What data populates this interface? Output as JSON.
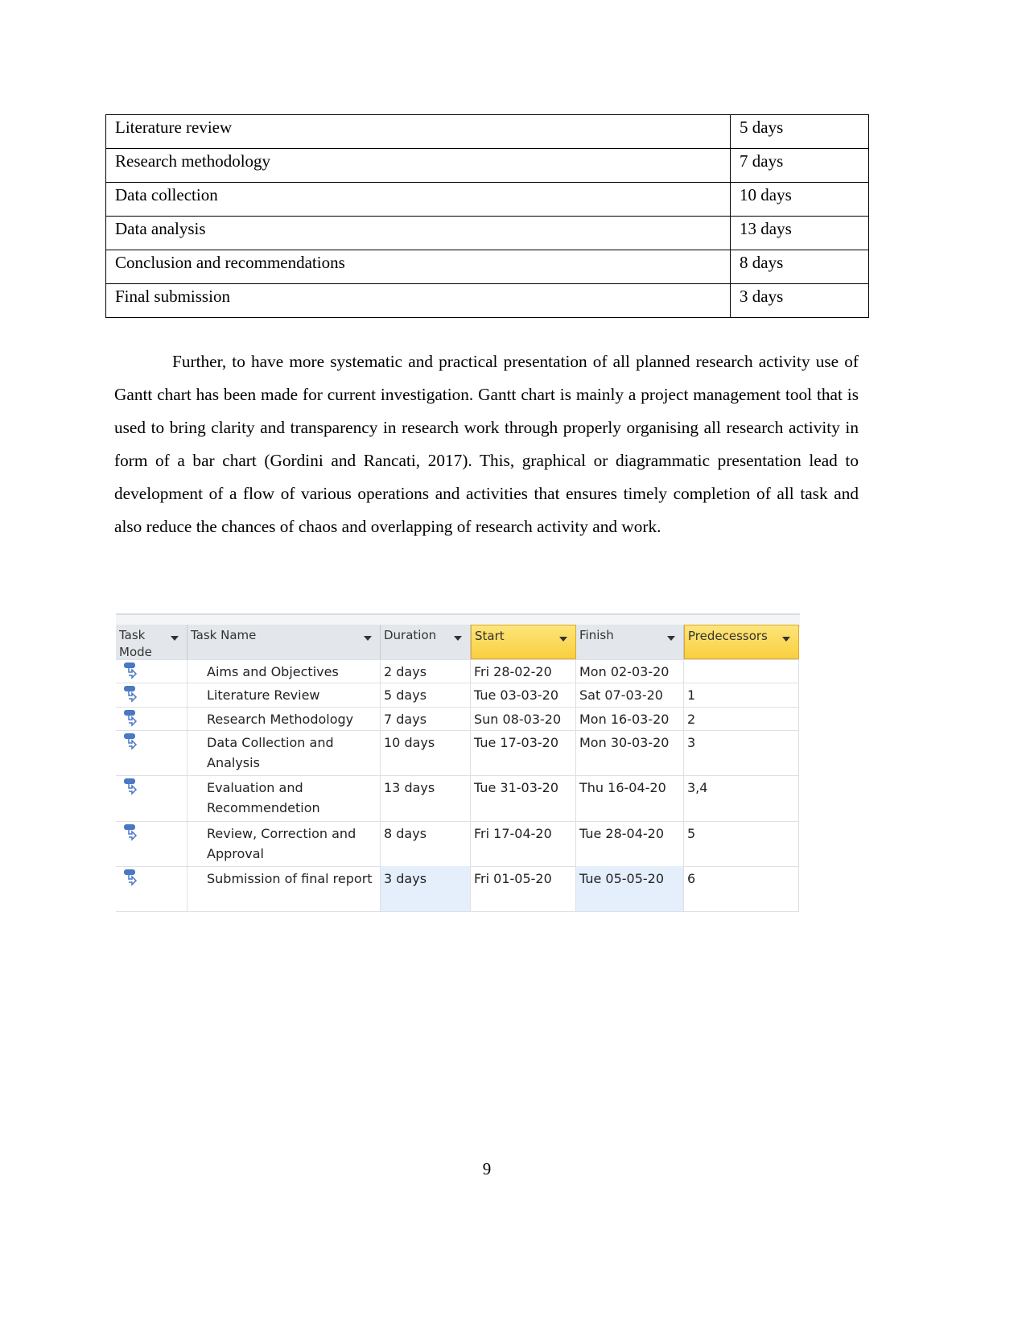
{
  "duration_table": [
    {
      "task": "Literature review",
      "duration": "5 days"
    },
    {
      "task": "Research methodology",
      "duration": "7 days"
    },
    {
      "task": "Data collection",
      "duration": "10 days"
    },
    {
      "task": "Data analysis",
      "duration": "13 days"
    },
    {
      "task": "Conclusion and recommendations",
      "duration": "8 days"
    },
    {
      "task": "Final submission",
      "duration": "3 days"
    }
  ],
  "paragraph": "Further, to have more systematic and practical presentation of all planned research activity use of Gantt chart has been made for current investigation. Gantt chart is mainly a project management tool that is used to bring clarity and transparency in research work through properly organising all research activity in form of a bar chart (Gordini and Rancati, 2017). This, graphical or diagrammatic presentation lead to development of a flow of various operations and activities that ensures timely completion of all task and also reduce the chances of chaos and overlapping of research activity and work.",
  "gantt": {
    "headers": [
      "Task Mode",
      "Task Name",
      "Duration",
      "Start",
      "Finish",
      "Predecessors"
    ],
    "highlight_color": "#f9cf3f",
    "task_mode_icon": "auto-scheduled-task-icon",
    "rows": [
      {
        "name": "Aims and Objectives",
        "duration": "2 days",
        "start": "Fri 28-02-20",
        "finish": "Mon 02-03-20",
        "pred": ""
      },
      {
        "name": "Literature Review",
        "duration": "5 days",
        "start": "Tue 03-03-20",
        "finish": "Sat 07-03-20",
        "pred": "1"
      },
      {
        "name": "Research Methodology",
        "duration": "7 days",
        "start": "Sun 08-03-20",
        "finish": "Mon 16-03-20",
        "pred": "2"
      },
      {
        "name": "Data Collection and Analysis",
        "duration": "10 days",
        "start": "Tue 17-03-20",
        "finish": "Mon 30-03-20",
        "pred": "3"
      },
      {
        "name": "Evaluation and Recommendetion",
        "duration": "13 days",
        "start": "Tue 31-03-20",
        "finish": "Thu 16-04-20",
        "pred": "3,4"
      },
      {
        "name": "Review, Correction and Approval",
        "duration": "8 days",
        "start": "Fri 17-04-20",
        "finish": "Tue 28-04-20",
        "pred": "5"
      },
      {
        "name": "Submission of final report",
        "duration": "3 days",
        "start": "Fri 01-05-20",
        "finish": "Tue 05-05-20",
        "pred": "6"
      }
    ]
  },
  "page_number": "9"
}
